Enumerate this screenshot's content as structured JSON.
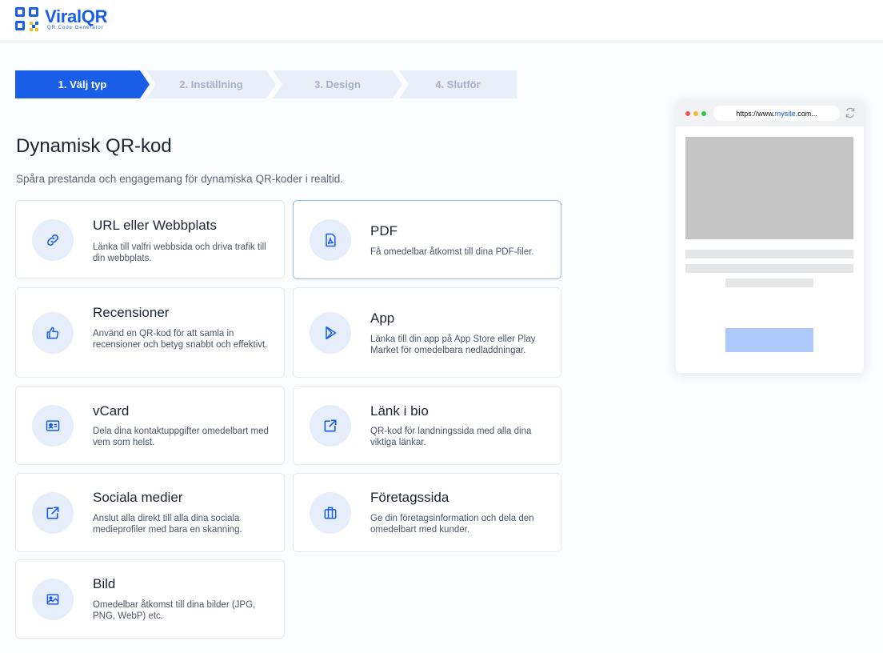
{
  "brand": {
    "name": "ViralQR",
    "tagline": "QR Code Generator"
  },
  "stepper": [
    {
      "label": "1. Välj typ",
      "active": true
    },
    {
      "label": "2. Inställning",
      "active": false
    },
    {
      "label": "3. Design",
      "active": false
    },
    {
      "label": "4. Slutför",
      "active": false
    }
  ],
  "page": {
    "title": "Dynamisk QR-kod",
    "subtitle": "Spåra prestanda och engagemang för dynamiska QR-koder i realtid."
  },
  "cards": [
    {
      "title": "URL eller Webbplats",
      "desc": "Länka till valfri webbsida och driva trafik till din webbplats.",
      "icon": "link-icon"
    },
    {
      "title": "PDF",
      "desc": "Få omedelbar åtkomst till dina PDF-filer.",
      "icon": "pdf-icon",
      "selected": true
    },
    {
      "title": "Recensioner",
      "desc": "Använd en QR-kod för att samla in recensioner och betyg snabbt och effektivt.",
      "icon": "thumbs-up-icon"
    },
    {
      "title": "App",
      "desc": "Länka till din app på App Store eller Play Market för omedelbara nedladdningar.",
      "icon": "play-icon"
    },
    {
      "title": "vCard",
      "desc": "Dela dina kontaktuppgifter omedelbart med vem som helst.",
      "icon": "contact-card-icon"
    },
    {
      "title": "Länk i bio",
      "desc": "QR-kod för landningssida med alla dina viktiga länkar.",
      "icon": "external-link-icon"
    },
    {
      "title": "Sociala medier",
      "desc": "Anslut alla direkt till alla dina sociala medieprofiler med bara en skanning.",
      "icon": "share-icon"
    },
    {
      "title": "Företagssida",
      "desc": "Ge din företagsinformation och dela den omedelbart med kunder.",
      "icon": "briefcase-icon"
    },
    {
      "title": "Bild",
      "desc": "Omedelbar åtkomst till dina bilder (JPG, PNG, WebP) etc.",
      "icon": "image-icon"
    }
  ],
  "preview": {
    "url_prefix": "https://www.",
    "url_highlight": "mysite",
    "url_suffix": ".com..."
  },
  "colors": {
    "accent": "#1a5ee8",
    "step_inactive": "#e9eff9",
    "icon_bg": "#e6edfb"
  }
}
